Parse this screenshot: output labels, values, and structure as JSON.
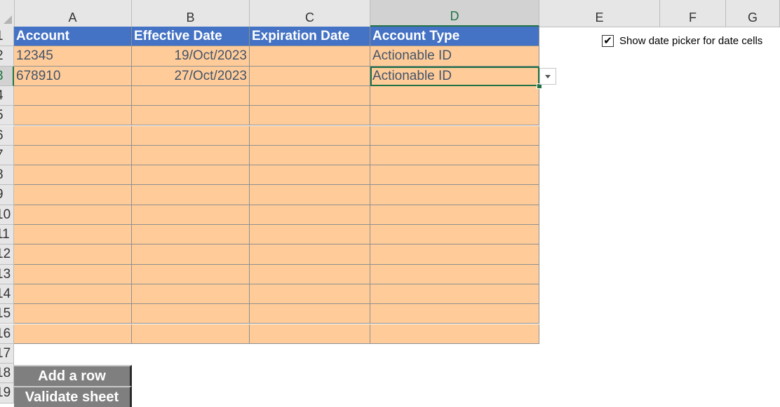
{
  "sheet": {
    "columns": [
      "A",
      "B",
      "C",
      "D",
      "E",
      "F",
      "G"
    ],
    "active_column": "D",
    "rows": [
      "1",
      "2",
      "3",
      "4",
      "5",
      "6",
      "7",
      "8",
      "9",
      "10",
      "11",
      "12",
      "13",
      "14",
      "15",
      "16",
      "17",
      "18",
      "19"
    ],
    "active_row": "3",
    "selected_cell": "D3"
  },
  "table": {
    "headers": [
      "Account",
      "Effective Date",
      "Expiration Date",
      "Account Type"
    ],
    "rows": [
      [
        "12345",
        "19/Oct/2023",
        "",
        "Actionable ID"
      ],
      [
        "678910",
        "27/Oct/2023",
        "",
        "Actionable ID"
      ]
    ],
    "header_color": "#4472c4",
    "cell_color": "#ffcc99"
  },
  "checkbox": {
    "label": "Show date picker for date cells",
    "checked": true,
    "glyph": "✔"
  },
  "buttons": {
    "add_row": "Add a row",
    "validate": "Validate sheet"
  },
  "icons": {
    "dropdown": "chevron-down-icon",
    "corner": "select-all-triangle"
  }
}
